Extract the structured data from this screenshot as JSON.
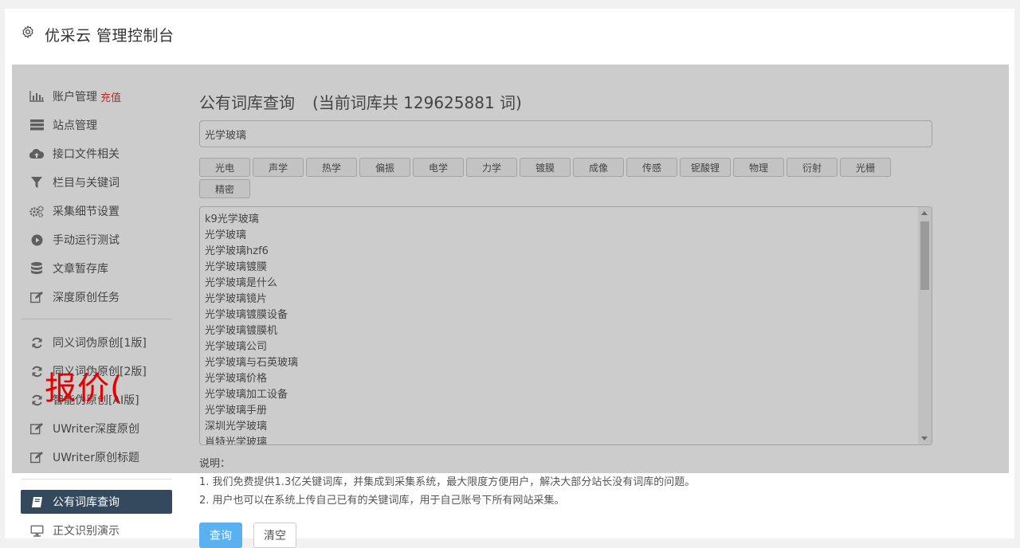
{
  "header": {
    "title": "优采云 管理控制台",
    "icon": "gear-icon"
  },
  "sidebar": {
    "items": [
      {
        "label": "账户管理",
        "badge": "充值",
        "icon": "bar-chart-icon"
      },
      {
        "label": "站点管理",
        "icon": "server-icon"
      },
      {
        "label": "接口文件相关",
        "icon": "cloud-upload-icon"
      },
      {
        "label": "栏目与关键词",
        "icon": "filter-icon"
      },
      {
        "label": "采集细节设置",
        "icon": "gears-icon"
      },
      {
        "label": "手动运行测试",
        "icon": "play-circle-icon"
      },
      {
        "label": "文章暂存库",
        "icon": "database-icon"
      },
      {
        "label": "深度原创任务",
        "icon": "edit-icon"
      },
      {
        "label": "同义词伪原创[1版]",
        "icon": "refresh-icon"
      },
      {
        "label": "同义词伪原创[2版]",
        "icon": "refresh-icon"
      },
      {
        "label": "智能伪原创[AI版]",
        "icon": "refresh-icon"
      },
      {
        "label": "UWriter深度原创",
        "icon": "edit-icon"
      },
      {
        "label": "UWriter原创标题",
        "icon": "edit-icon"
      },
      {
        "label": "公有词库查询",
        "icon": "book-icon"
      },
      {
        "label": "正文识别演示",
        "icon": "monitor-icon"
      }
    ]
  },
  "content": {
    "title": "公有词库查询",
    "count_text": "(当前词库共 129625881 词)",
    "search_value": "光学玻璃",
    "tags": [
      "光电",
      "声学",
      "热学",
      "偏振",
      "电学",
      "力学",
      "镀膜",
      "成像",
      "传感",
      "铌酸锂",
      "物理",
      "衍射",
      "光栅",
      "精密"
    ],
    "results": [
      "k9光学玻璃",
      "光学玻璃",
      "光学玻璃hzf6",
      "光学玻璃镀膜",
      "光学玻璃是什么",
      "光学玻璃镜片",
      "光学玻璃镀膜设备",
      "光学玻璃镀膜机",
      "光学玻璃公司",
      "光学玻璃与石英玻璃",
      "光学玻璃价格",
      "光学玻璃加工设备",
      "光学玻璃手册",
      "深圳光学玻璃",
      "肖特光学玻璃"
    ],
    "notes_label": "说明：",
    "note1": "1. 我们免费提供1.3亿关键词库，并集成到采集系统，最大限度方便用户，解决大部分站长没有词库的问题。",
    "note2": "2. 用户也可以在系统上传自己已有的关键词库，用于自己账号下所有网站采集。",
    "query_button": "查询",
    "clear_button": "清空"
  },
  "overlay_text": "报价(",
  "colors": {
    "active_nav": "#34495e",
    "badge": "#e33333",
    "primary_button": "#5bb0f0",
    "watermark": "#e60000"
  }
}
